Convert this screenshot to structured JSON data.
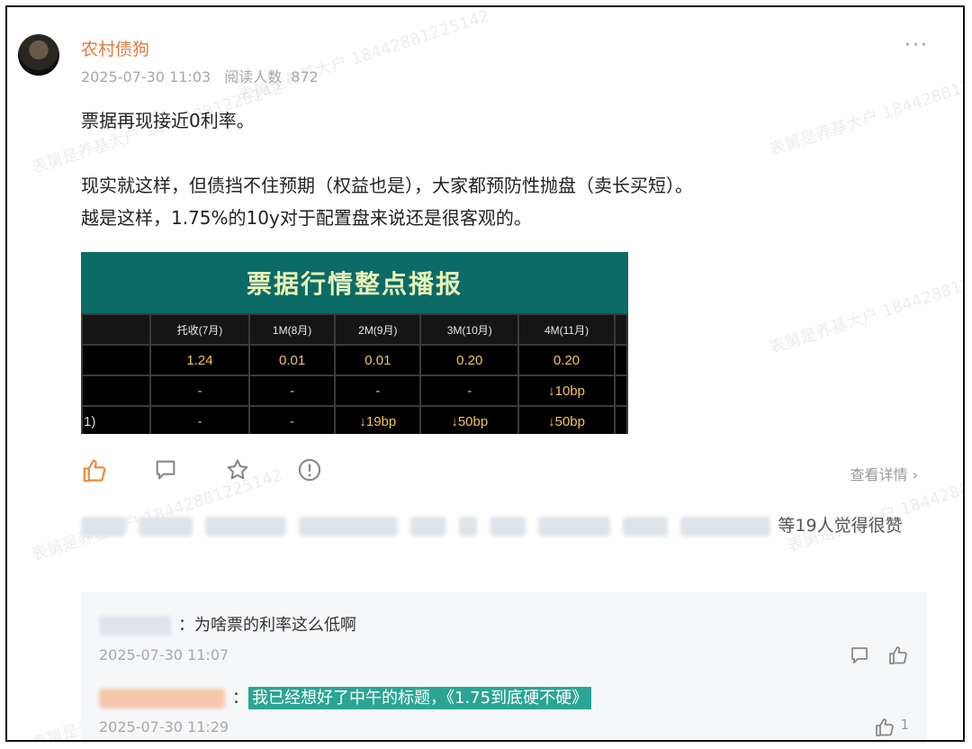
{
  "post": {
    "author": "农村债狗",
    "date": "2025-07-30 11:03",
    "reads_label": "阅读人数",
    "reads": "872",
    "more": "···",
    "lines": [
      "票据再现接近0利率。",
      "现实就这样，但债挡不住预期（权益也是），大家都预防性抛盘（卖长买短）。",
      "越是这样，1.75%的10y对于配置盘来说还是很客观的。"
    ]
  },
  "image": {
    "title": "票据行情整点播报",
    "headers": [
      "",
      "托收(7月)",
      "1M(8月)",
      "2M(9月)",
      "3M(10月)",
      "4M(11月)",
      ""
    ],
    "rows": [
      [
        "",
        "1.24",
        "0.01",
        "0.01",
        "0.20",
        "0.20",
        ""
      ],
      [
        "",
        "-",
        "-",
        "-",
        "-",
        "↓10bp",
        ""
      ],
      [
        "1)",
        "-",
        "-",
        "↓19bp",
        "↓50bp",
        "↓50bp",
        ""
      ]
    ]
  },
  "actions": {
    "detail": "查看详情",
    "likes_suffix": "等19人觉得很赞"
  },
  "comments": [
    {
      "text": "为啥票的利率这么低啊",
      "time": "2025-07-30 11:07",
      "like_count": ""
    },
    {
      "text": "我已经想好了中午的标题，《1.75到底硬不硬》",
      "time": "2025-07-30 11:29",
      "like_count": "1"
    }
  ],
  "watermark": "表舅是养基大户 18442881225142",
  "colors": {
    "accent": "#e07a3c",
    "highlight": "#2aa594",
    "image_header": "#0b6b66"
  }
}
